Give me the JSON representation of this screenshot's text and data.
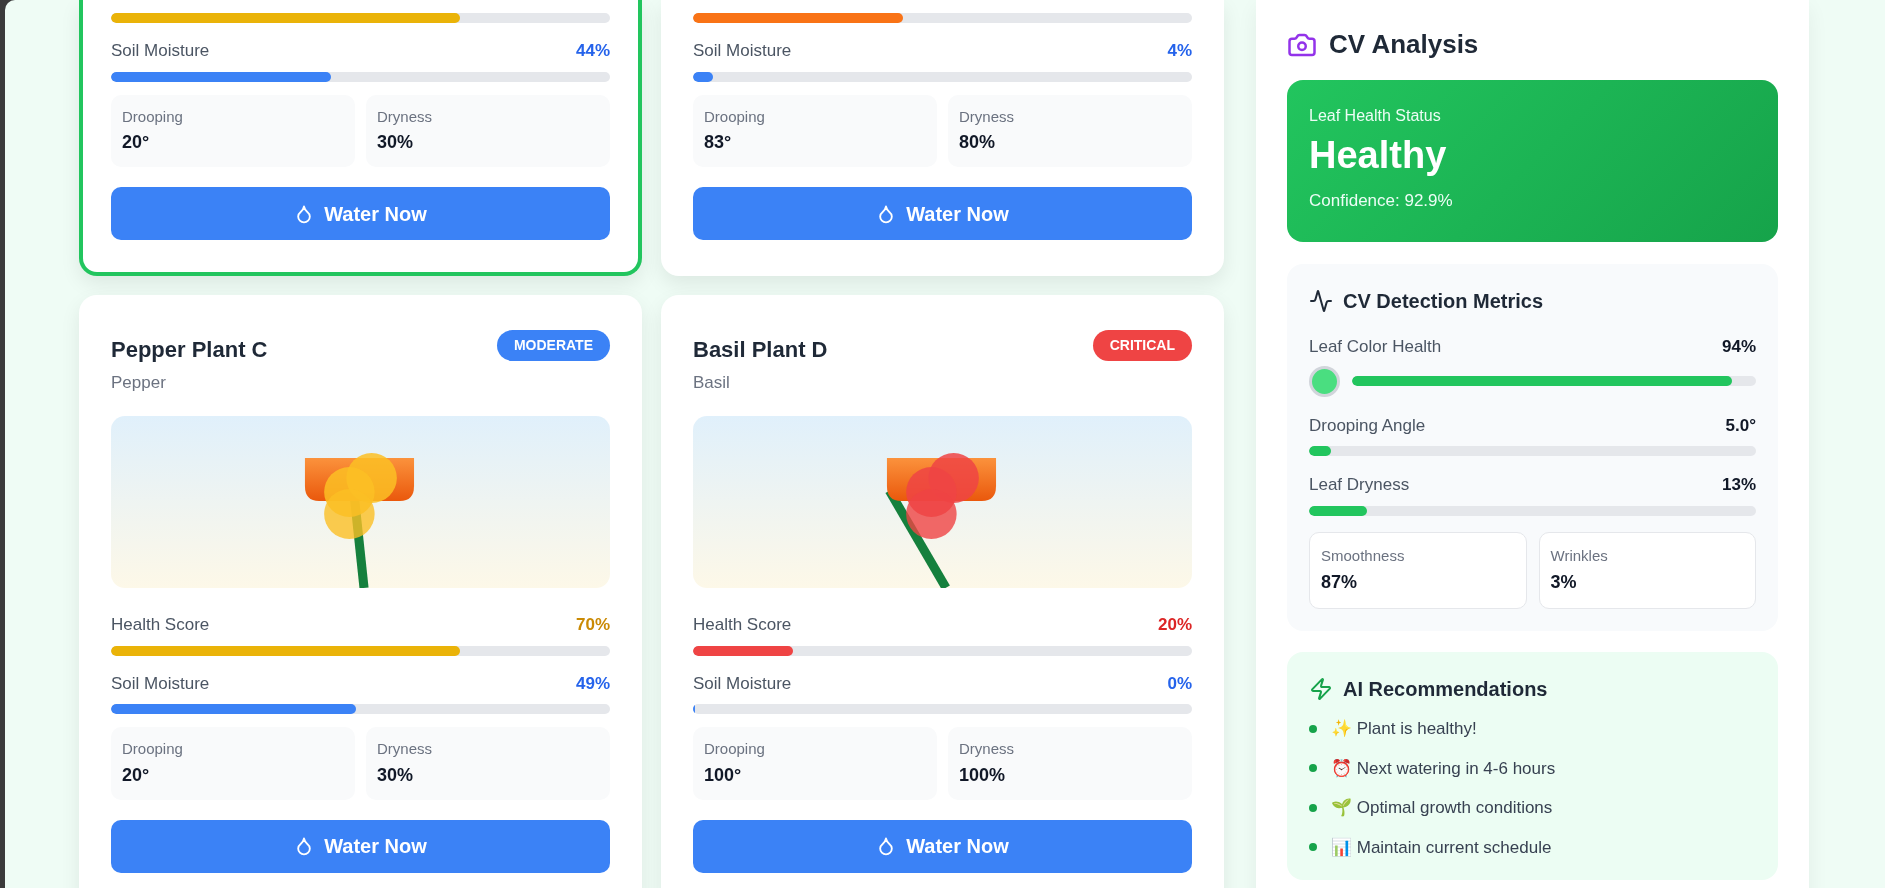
{
  "top_cards": [
    {
      "selected": true,
      "health": {
        "level": 0.7
      },
      "moisture": {
        "label": "Soil Moisture",
        "reading": "44%",
        "level": 0.44
      },
      "stats": [
        {
          "label": "Drooping",
          "value": "20°"
        },
        {
          "label": "Dryness",
          "value": "30%"
        }
      ],
      "button": "Water Now"
    },
    {
      "selected": false,
      "health": {
        "level": 0.42
      },
      "moisture": {
        "label": "Soil Moisture",
        "reading": "4%",
        "level": 0.04
      },
      "stats": [
        {
          "label": "Drooping",
          "value": "83°"
        },
        {
          "label": "Dryness",
          "value": "80%"
        }
      ],
      "button": "Water Now"
    }
  ],
  "bottom_cards": [
    {
      "selected": false,
      "name": "Pepper Plant C",
      "species": "Pepper",
      "status": {
        "kind": "moderate",
        "label": "MODERATE"
      },
      "health": {
        "label": "Health Score",
        "reading": "70%",
        "level": 0.7
      },
      "moisture": {
        "label": "Soil Moisture",
        "reading": "49%",
        "level": 0.49
      },
      "stats": [
        {
          "label": "Drooping",
          "value": "20°"
        },
        {
          "label": "Dryness",
          "value": "30%"
        }
      ],
      "button": "Water Now"
    },
    {
      "selected": false,
      "name": "Basil Plant D",
      "species": "Basil",
      "status": {
        "kind": "critical",
        "label": "CRITICAL"
      },
      "health": {
        "label": "Health Score",
        "reading": "20%",
        "level": 0.2
      },
      "moisture": {
        "label": "Soil Moisture",
        "reading": "0%",
        "level": 0
      },
      "stats": [
        {
          "label": "Drooping",
          "value": "100°"
        },
        {
          "label": "Dryness",
          "value": "100%"
        }
      ],
      "button": "Water Now"
    }
  ],
  "cv_panel": {
    "title": "CV Analysis",
    "status_card": {
      "label": "Leaf Health Status",
      "status": "Healthy",
      "confidence": "Confidence: 92.9%"
    },
    "metrics": {
      "title": "CV Detection Metrics",
      "items": [
        {
          "kind": "swatch",
          "label": "Leaf Color Health",
          "reading": "94%",
          "level": 0.94,
          "color": "#4ade80"
        },
        {
          "kind": "bar",
          "label": "Drooping Angle",
          "reading": "5.0°",
          "level": 0.05
        },
        {
          "kind": "bar",
          "label": "Leaf Dryness",
          "reading": "13%",
          "level": 0.13
        }
      ],
      "tiles": [
        {
          "label": "Smoothness",
          "value": "87%"
        },
        {
          "label": "Wrinkles",
          "value": "3%"
        }
      ]
    },
    "recommendations": {
      "title": "AI Recommendations",
      "items": [
        "✨ Plant is healthy!",
        "⏰ Next watering in 4-6 hours",
        "🌱 Optimal growth conditions",
        "📊 Maintain current schedule"
      ]
    }
  }
}
